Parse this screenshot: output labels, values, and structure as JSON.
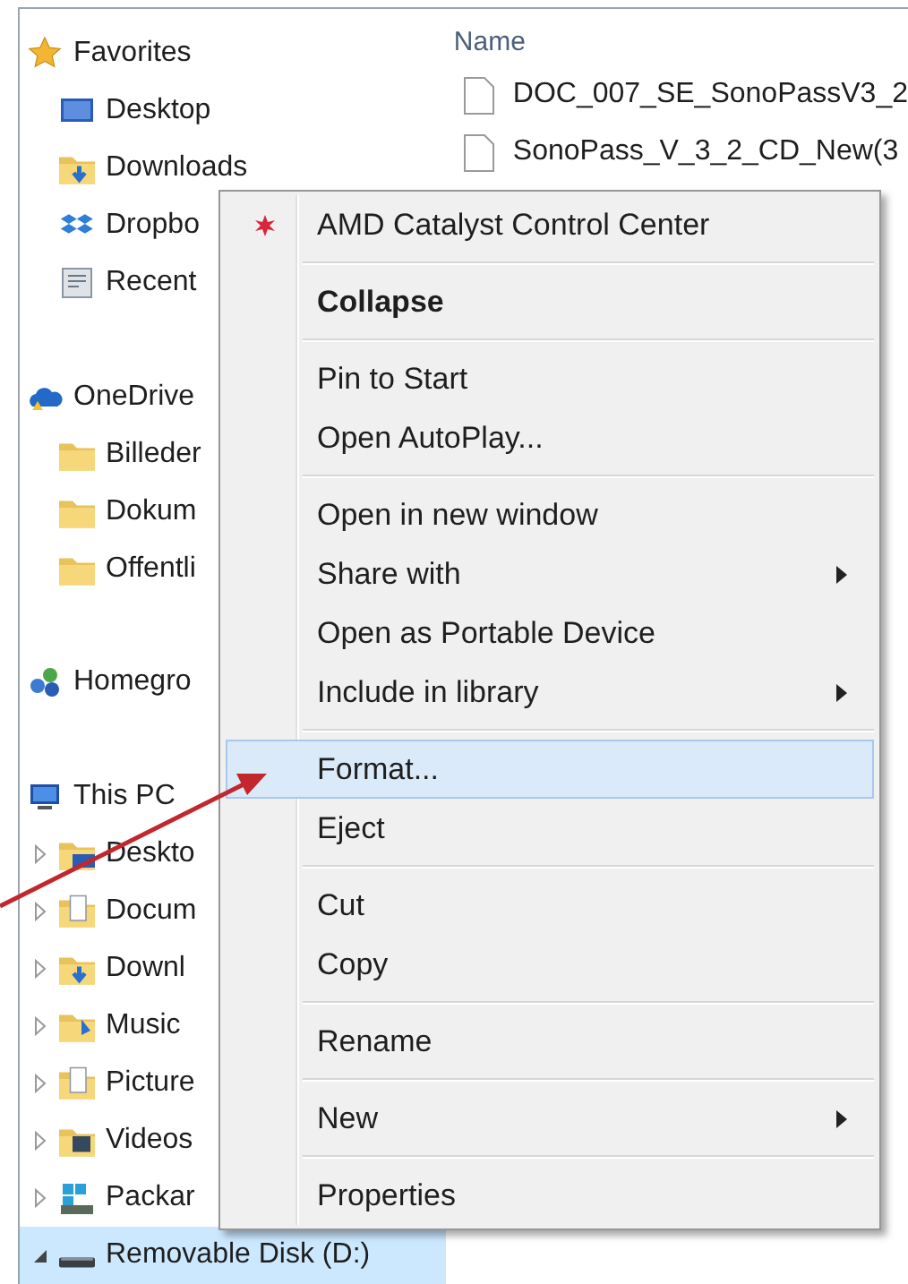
{
  "navigation_pane": {
    "items": [
      {
        "label": "Favorites",
        "kind": "star",
        "selected": false,
        "children": [
          {
            "label": "Desktop",
            "kind": "monitor",
            "selected": false
          },
          {
            "label": "Downloads",
            "kind": "download-folder",
            "selected": false
          },
          {
            "label": "Dropbo",
            "kind": "dropbox",
            "selected": false
          },
          {
            "label": "Recent",
            "kind": "recent",
            "selected": false
          }
        ]
      },
      {
        "label": "OneDrive",
        "kind": "cloud",
        "selected": false,
        "children": [
          {
            "label": "Billeder",
            "kind": "folder",
            "selected": false
          },
          {
            "label": "Dokum",
            "kind": "folder",
            "selected": false
          },
          {
            "label": "Offentli",
            "kind": "folder",
            "selected": false
          }
        ]
      },
      {
        "label": "Homegro",
        "kind": "network",
        "selected": false
      },
      {
        "label": "This PC",
        "kind": "computer",
        "selected": false,
        "children": [
          {
            "label": "Deskto",
            "kind": "monitor-folder",
            "selected": false,
            "expanded": false
          },
          {
            "label": "Docum",
            "kind": "doc-folder",
            "selected": false,
            "expanded": false
          },
          {
            "label": "Downl",
            "kind": "download-folder",
            "selected": false,
            "expanded": false
          },
          {
            "label": "Music",
            "kind": "music-folder",
            "selected": false,
            "expanded": false
          },
          {
            "label": "Picture",
            "kind": "doc-folder",
            "selected": false,
            "expanded": false
          },
          {
            "label": "Videos",
            "kind": "video-folder",
            "selected": false,
            "expanded": false
          },
          {
            "label": "Packar",
            "kind": "apps",
            "selected": false,
            "expanded": false
          },
          {
            "label": "Removable Disk (D:)",
            "kind": "drive",
            "selected": true,
            "expanded": true
          }
        ]
      }
    ]
  },
  "file_list": {
    "column_header": "Name",
    "files": [
      {
        "name": "DOC_007_SE_SonoPassV3_2"
      },
      {
        "name": "SonoPass_V_3_2_CD_New(3"
      }
    ]
  },
  "context_menu": {
    "sections": [
      [
        {
          "label": "AMD Catalyst Control Center",
          "kind": "app",
          "bold": false,
          "submenu": false,
          "selected": false
        }
      ],
      [
        {
          "label": "Collapse",
          "kind": "plain",
          "bold": true,
          "submenu": false,
          "selected": false
        }
      ],
      [
        {
          "label": "Pin to Start",
          "kind": "plain",
          "bold": false,
          "submenu": false,
          "selected": false
        },
        {
          "label": "Open AutoPlay...",
          "kind": "plain",
          "bold": false,
          "submenu": false,
          "selected": false
        }
      ],
      [
        {
          "label": "Open in new window",
          "kind": "plain",
          "bold": false,
          "submenu": false,
          "selected": false
        },
        {
          "label": "Share with",
          "kind": "plain",
          "bold": false,
          "submenu": true,
          "selected": false
        },
        {
          "label": "Open as Portable Device",
          "kind": "plain",
          "bold": false,
          "submenu": false,
          "selected": false
        },
        {
          "label": "Include in library",
          "kind": "plain",
          "bold": false,
          "submenu": true,
          "selected": false
        }
      ],
      [
        {
          "label": "Format...",
          "kind": "plain",
          "bold": false,
          "submenu": false,
          "selected": true
        },
        {
          "label": "Eject",
          "kind": "plain",
          "bold": false,
          "submenu": false,
          "selected": false
        }
      ],
      [
        {
          "label": "Cut",
          "kind": "plain",
          "bold": false,
          "submenu": false,
          "selected": false
        },
        {
          "label": "Copy",
          "kind": "plain",
          "bold": false,
          "submenu": false,
          "selected": false
        }
      ],
      [
        {
          "label": "Rename",
          "kind": "plain",
          "bold": false,
          "submenu": false,
          "selected": false
        }
      ],
      [
        {
          "label": "New",
          "kind": "plain",
          "bold": false,
          "submenu": true,
          "selected": false
        }
      ],
      [
        {
          "label": "Properties",
          "kind": "plain",
          "bold": false,
          "submenu": false,
          "selected": false
        }
      ]
    ]
  }
}
